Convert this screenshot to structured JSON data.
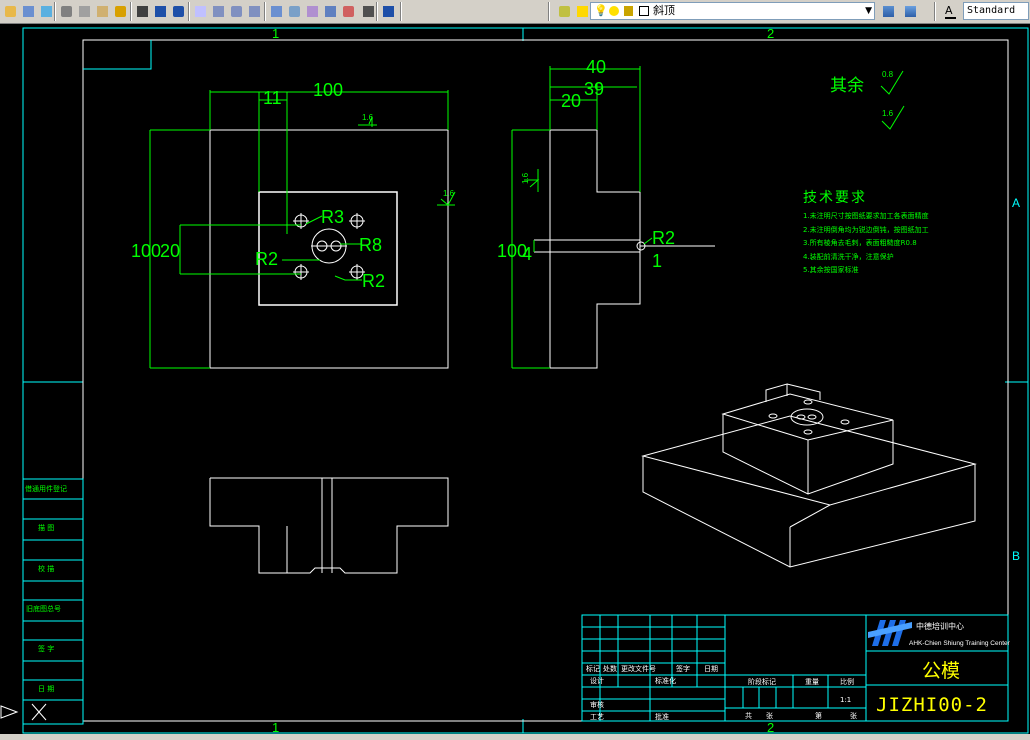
{
  "toolbar": {
    "buttons": [
      "open-icon",
      "print-icon",
      "publish-icon",
      "cut-icon",
      "copy-icon",
      "paste-icon",
      "match-properties-icon",
      "pen-icon",
      "undo-icon",
      "redo-icon",
      "pan-icon",
      "zoom-realtime-icon",
      "zoom-window-icon",
      "zoom-previous-icon",
      "properties-icon",
      "design-center-icon",
      "tool-palettes-icon",
      "sheet-set-icon",
      "markup-icon",
      "calculator-icon",
      "help-icon",
      "layer-manager-icon",
      "layer-state-icon",
      "layer-on-icon",
      "layer-freeze-icon",
      "layer-lock-icon",
      "layer-previous-icon",
      "text-style-icon"
    ],
    "layer_value": "斜顶",
    "text_style_value": "Standard"
  },
  "frame": {
    "col_labels": [
      "1",
      "2"
    ],
    "row_labels": [
      "A",
      "B"
    ],
    "left_strip_labels": [
      "借通用件登记",
      "描  图",
      "校  描",
      "旧底图总号",
      "签  字",
      "日  期"
    ]
  },
  "drawing": {
    "front_view_dims": [
      "100",
      "11",
      "100",
      "20",
      "R3",
      "R8",
      "R2",
      "R2"
    ],
    "side_view_dims": [
      "40",
      "39",
      "20",
      "100",
      "4",
      "R2",
      "1"
    ],
    "roughness_values": [
      "1.6",
      "1.6",
      "1.6",
      "0.8",
      "1.6"
    ],
    "other_label": "其余"
  },
  "tech_requirements": {
    "title": "技术要求",
    "lines": [
      "1.未注明尺寸按图纸要求加工各表面精度",
      "2.未注明倒角均为锐边倒钝，按图纸加工",
      "3.所有棱角去毛刺，表面粗糙度R0.8",
      "4.装配前清洗干净，注意保护",
      "5.其余按国家标准"
    ]
  },
  "title_block": {
    "company": "中德培训中心",
    "company_en": "AHK-Chien Shiung Training Center",
    "part_name": "公模",
    "drawing_number": "JIZHI00-2",
    "scale": "1:1",
    "header_labels": [
      "标记",
      "处数",
      "更改文件号",
      "签字",
      "日期"
    ],
    "stage_labels": [
      "阶段标记",
      "重量",
      "比例"
    ],
    "sheet_labels": [
      "共",
      "张",
      "第",
      "张"
    ],
    "role_labels": [
      "设计",
      "审核",
      "工艺",
      "标准化",
      "批准"
    ]
  },
  "colors": {
    "background": "#000000",
    "geometry": "#ffffff",
    "dimension": "#00ff00",
    "frame": "#00ffff",
    "title": "#ffff00"
  }
}
